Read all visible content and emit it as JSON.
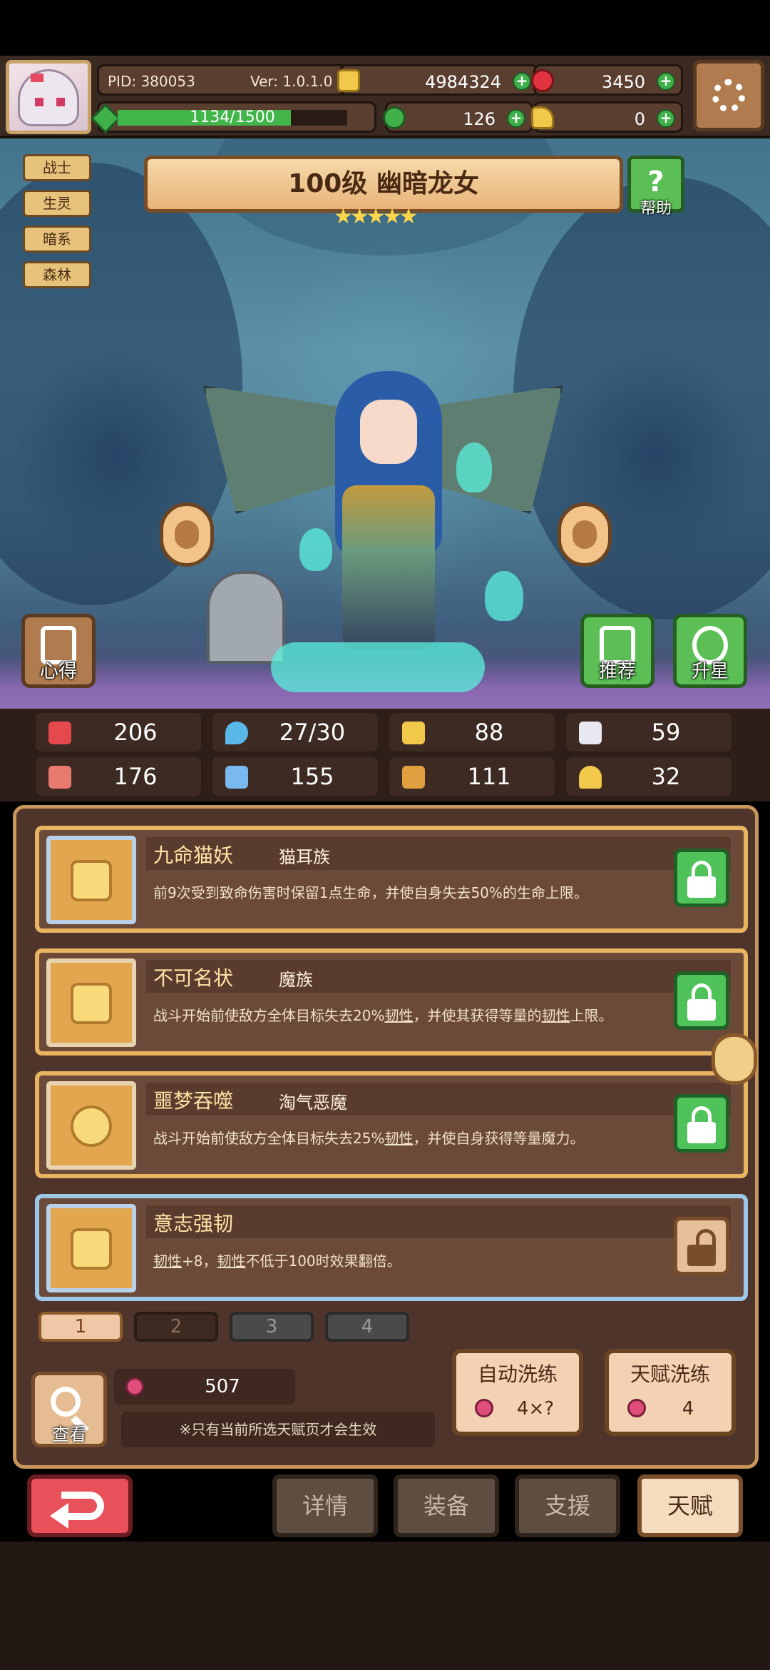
{
  "header": {
    "pid": "PID: 380053",
    "version": "Ver: 1.0.1.0",
    "coins": "4984324",
    "gems": "3450",
    "xp": "1134/1500",
    "xp_fraction": 0.756,
    "clover": "126",
    "tickets": "0",
    "plus_symbol": "+"
  },
  "tags": [
    "战士",
    "生灵",
    "暗系",
    "森林"
  ],
  "hero": {
    "title": "100级 幽暗龙女",
    "stars": "★★★★★",
    "help_label": "帮助",
    "help_icon": "?"
  },
  "side_buttons": {
    "xinde": "心得",
    "recommend": "推荐",
    "star_up": "升星"
  },
  "stats": [
    {
      "icon": "heart-icon",
      "color": "#e5484d",
      "value": "206"
    },
    {
      "icon": "drop-icon",
      "color": "#5ab8e8",
      "value": "27/30"
    },
    {
      "icon": "shield-icon",
      "color": "#f2c84a",
      "value": "88"
    },
    {
      "icon": "wing-icon",
      "color": "#e8e8f0",
      "value": "59"
    },
    {
      "icon": "fist-icon",
      "color": "#e87a70",
      "value": "176"
    },
    {
      "icon": "book-icon",
      "color": "#7ab8f0",
      "value": "155"
    },
    {
      "icon": "scroll-icon",
      "color": "#e0a040",
      "value": "111"
    },
    {
      "icon": "horseshoe-icon",
      "color": "#f2c84a",
      "value": "32"
    }
  ],
  "talents": [
    {
      "name": "九命猫妖",
      "race": "猫耳族",
      "desc": "前9次受到致命伤害时保留1点生命，并使自身失去50%的生命上限。",
      "locked": true
    },
    {
      "name": "不可名状",
      "race": "魔族",
      "desc_parts": [
        "战斗开始前使敌方全体目标失去20%",
        "韧性",
        "，并使其获得等量的",
        "韧性",
        "上限。"
      ],
      "locked": true
    },
    {
      "name": "噩梦吞噬",
      "race": "淘气恶魔",
      "desc_parts": [
        "战斗开始前使敌方全体目标失去25%",
        "韧性",
        "，并使自身获得等量魔力。"
      ],
      "locked": true
    },
    {
      "name": "意志强韧",
      "race": "",
      "desc_parts": [
        "韧性",
        "+8，",
        "韧性",
        "不低于100时效果翻倍。"
      ],
      "locked": false
    }
  ],
  "pages": [
    "1",
    "2",
    "3",
    "4"
  ],
  "bottom": {
    "view_label": "查看",
    "potion_count": "507",
    "note": "※只有当前所选天赋页才会生效",
    "auto_wash": "自动洗练",
    "auto_wash_cost": "4×?",
    "talent_wash": "天赋洗练",
    "talent_wash_cost": "4"
  },
  "nav": {
    "details": "详情",
    "equipment": "装备",
    "support": "支援",
    "talent": "天赋"
  }
}
